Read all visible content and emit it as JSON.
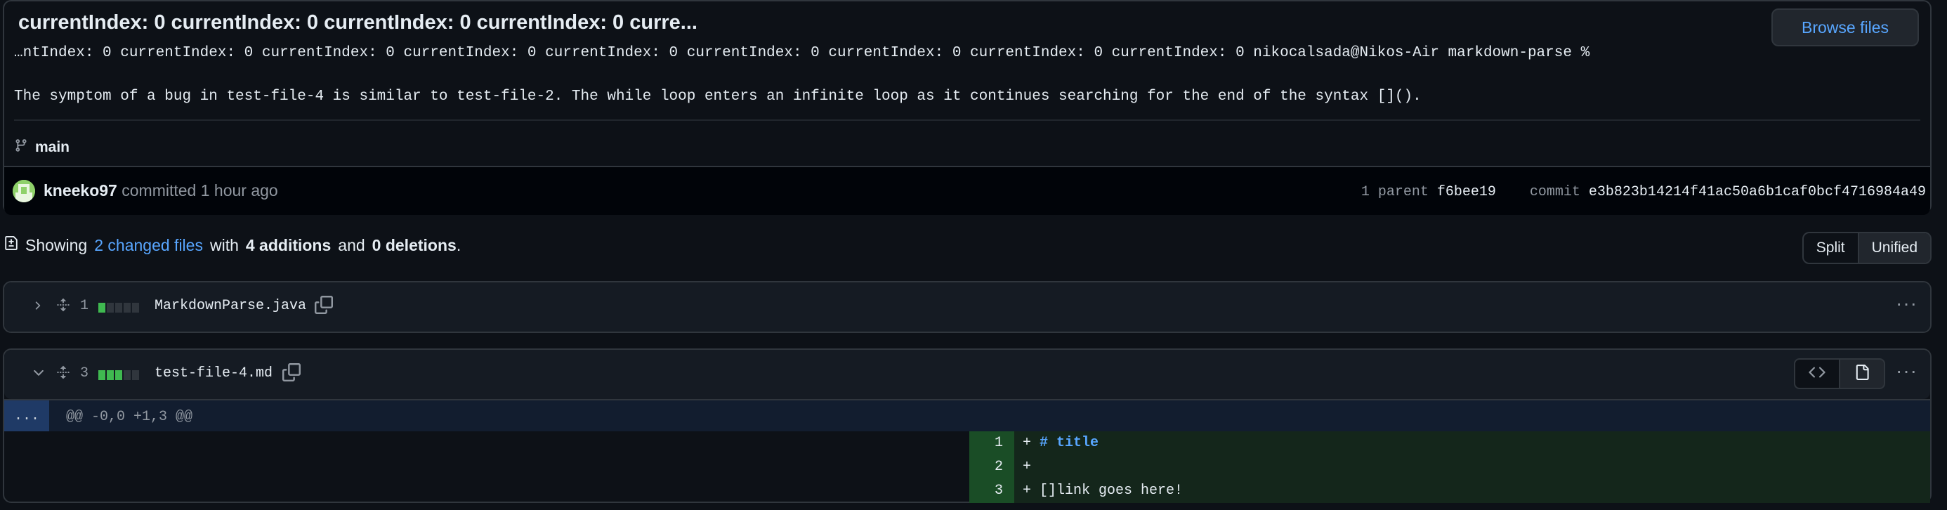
{
  "commit": {
    "title": "currentIndex: 0 currentIndex: 0 currentIndex: 0 currentIndex: 0 curre...",
    "browse_files_label": "Browse files",
    "description_line1": "…ntIndex: 0 currentIndex: 0 currentIndex: 0 currentIndex: 0 currentIndex: 0 currentIndex: 0 currentIndex: 0 currentIndex: 0 currentIndex: 0 nikocalsada@Nikos-Air markdown-parse %",
    "description_line2": "The symptom of a bug in test-file-4 is similar to test-file-2. The while loop enters an infinite loop as it continues searching for the end of the syntax [](). ",
    "branch": "main",
    "author": "kneeko97",
    "committed_text": "committed 1 hour ago",
    "parent_label": "1 parent",
    "parent_sha": "f6bee19",
    "commit_label": "commit",
    "commit_sha": "e3b823b14214f41ac50a6b1caf0bcf4716984a49"
  },
  "summary": {
    "showing": "Showing",
    "changed_files": "2 changed files",
    "with": "with",
    "additions": "4 additions",
    "and": "and",
    "deletions": "0 deletions",
    "period": "."
  },
  "view_toggle": {
    "split": "Split",
    "unified": "Unified",
    "selected": "Unified"
  },
  "files": [
    {
      "count": "1",
      "name": "MarkdownParse.java",
      "expanded": false,
      "diffstat": [
        "added",
        "neutral",
        "neutral",
        "neutral",
        "neutral"
      ]
    },
    {
      "count": "3",
      "name": "test-file-4.md",
      "expanded": true,
      "diffstat": [
        "added",
        "added",
        "added",
        "neutral",
        "neutral"
      ],
      "hunk_expander": "...",
      "hunk_header": "@@ -0,0 +1,3 @@",
      "lines": [
        {
          "num": "1",
          "prefix": "+ ",
          "code": "# title"
        },
        {
          "num": "2",
          "prefix": "+",
          "code": ""
        },
        {
          "num": "3",
          "prefix": "+ ",
          "code": "[]link goes here!"
        }
      ]
    }
  ],
  "colors": {
    "added": "#3fb950",
    "neutral": "#30363d",
    "link": "#58a6ff"
  }
}
